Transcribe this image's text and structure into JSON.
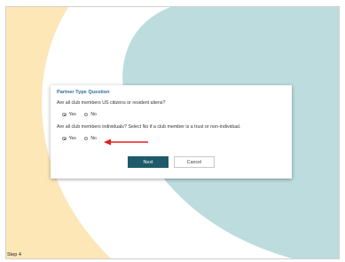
{
  "dialog": {
    "title": "Partner Type Question",
    "q1": {
      "text": "Are all club members US citizens or resident aliens?",
      "yes_label": "Yes",
      "no_label": "No",
      "selected": "Yes"
    },
    "q2": {
      "text": "Are all club members individuals? Select No if a club member is a trust or non-individual.",
      "yes_label": "Yes",
      "no_label": "No",
      "selected": "Yes"
    },
    "next_label": "Next",
    "cancel_label": "Cancel"
  },
  "step_label": "Step 4",
  "colors": {
    "background_yellow": "#fde7b6",
    "background_teal": "#bcdcde",
    "title_blue": "#2e6f9a",
    "next_button": "#1e5a69",
    "arrow_red": "#e02020"
  }
}
